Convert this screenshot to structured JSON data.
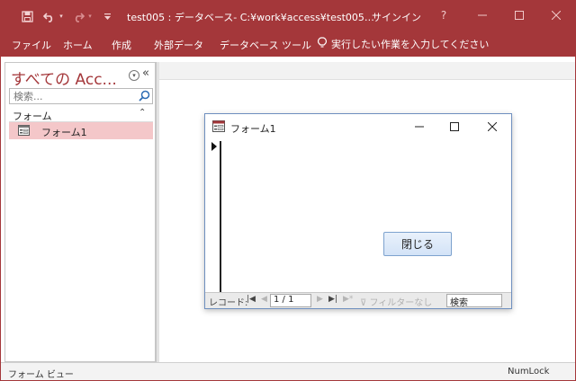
{
  "colors": {
    "accent": "#a4373a",
    "selected_item": "#f4c7c9",
    "button_border": "#7da2ce"
  },
  "titlebar": {
    "title": "test005 : データベース- C:¥work¥access¥test005…",
    "signin": "サインイン",
    "help": "?",
    "icons": [
      "save-icon",
      "undo-icon",
      "redo-icon",
      "customize-qat-icon",
      "minimize-icon",
      "maximize-icon",
      "close-icon"
    ]
  },
  "ribbon": {
    "tabs": [
      "ファイル",
      "ホーム",
      "作成",
      "外部データ",
      "データベース ツール"
    ],
    "tellme": "実行したい作業を入力してください"
  },
  "nav": {
    "title": "すべての Acc...",
    "search_placeholder": "検索...",
    "group": "フォーム",
    "items": [
      "フォーム1"
    ]
  },
  "form": {
    "title": "フォーム1",
    "close_button": "閉じる",
    "recnav": {
      "label": "レコード:",
      "position": "1 / 1",
      "filter": "フィルターなし",
      "search": "検索"
    }
  },
  "status": {
    "left": "フォーム ビュー",
    "right": "NumLock"
  }
}
